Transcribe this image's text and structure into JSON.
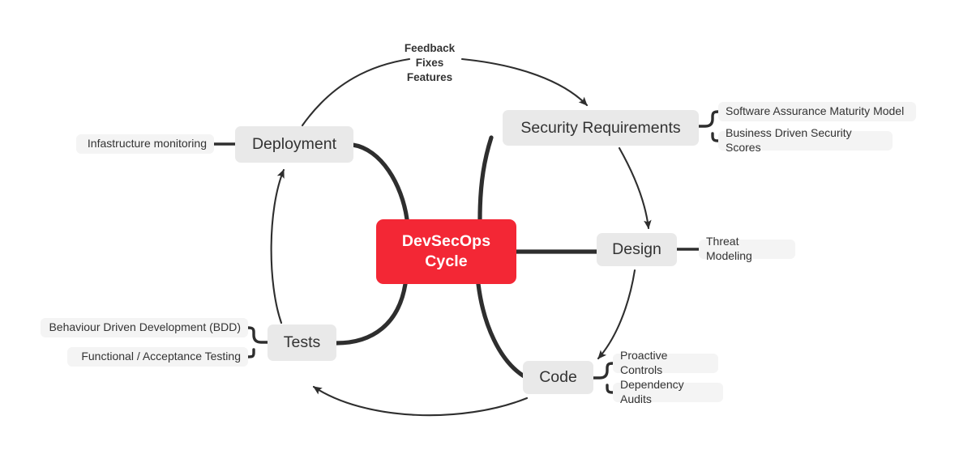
{
  "diagram": {
    "type": "mindmap",
    "title": "DevSecOps Cycle",
    "colors": {
      "central_fill": "#f32735",
      "central_text": "#ffffff",
      "branch_fill": "#e9e9e9",
      "leaf_fill": "#f4f4f4",
      "text": "#333333",
      "edge": "#2e2e2e",
      "background": "#ffffff"
    },
    "central": {
      "label": "DevSecOps\nCycle"
    },
    "branches": [
      {
        "id": "security-requirements",
        "label": "Security Requirements"
      },
      {
        "id": "design",
        "label": "Design"
      },
      {
        "id": "code",
        "label": "Code"
      },
      {
        "id": "tests",
        "label": "Tests"
      },
      {
        "id": "deployment",
        "label": "Deployment"
      }
    ],
    "leaves": [
      {
        "id": "software-assurance-maturity-model",
        "parent": "security-requirements",
        "label": "Software Assurance Maturity Model"
      },
      {
        "id": "business-driven-security-scores",
        "parent": "security-requirements",
        "label": "Business Driven Security Scores"
      },
      {
        "id": "threat-modeling",
        "parent": "design",
        "label": "Threat Modeling"
      },
      {
        "id": "proactive-controls",
        "parent": "code",
        "label": "Proactive Controls"
      },
      {
        "id": "dependency-audits",
        "parent": "code",
        "label": "Dependency Audits"
      },
      {
        "id": "behaviour-driven-development",
        "parent": "tests",
        "label": "Behaviour Driven Development (BDD)"
      },
      {
        "id": "functional-acceptance-testing",
        "parent": "tests",
        "label": "Functional / Acceptance Testing"
      },
      {
        "id": "infastructure-monitoring",
        "parent": "deployment",
        "label": "Infastructure monitoring"
      }
    ],
    "edge_labels": [
      {
        "id": "feedback-fixes-features",
        "label": "Feedback\nFixes\nFeatures",
        "from": "deployment",
        "to": "security-requirements"
      }
    ],
    "flow": [
      {
        "from": "deployment",
        "to": "security-requirements",
        "arrow": true
      },
      {
        "from": "security-requirements",
        "to": "design",
        "arrow": true
      },
      {
        "from": "design",
        "to": "code",
        "arrow": true
      },
      {
        "from": "code",
        "to": "tests",
        "arrow": true
      },
      {
        "from": "tests",
        "to": "deployment",
        "arrow": true
      }
    ]
  }
}
